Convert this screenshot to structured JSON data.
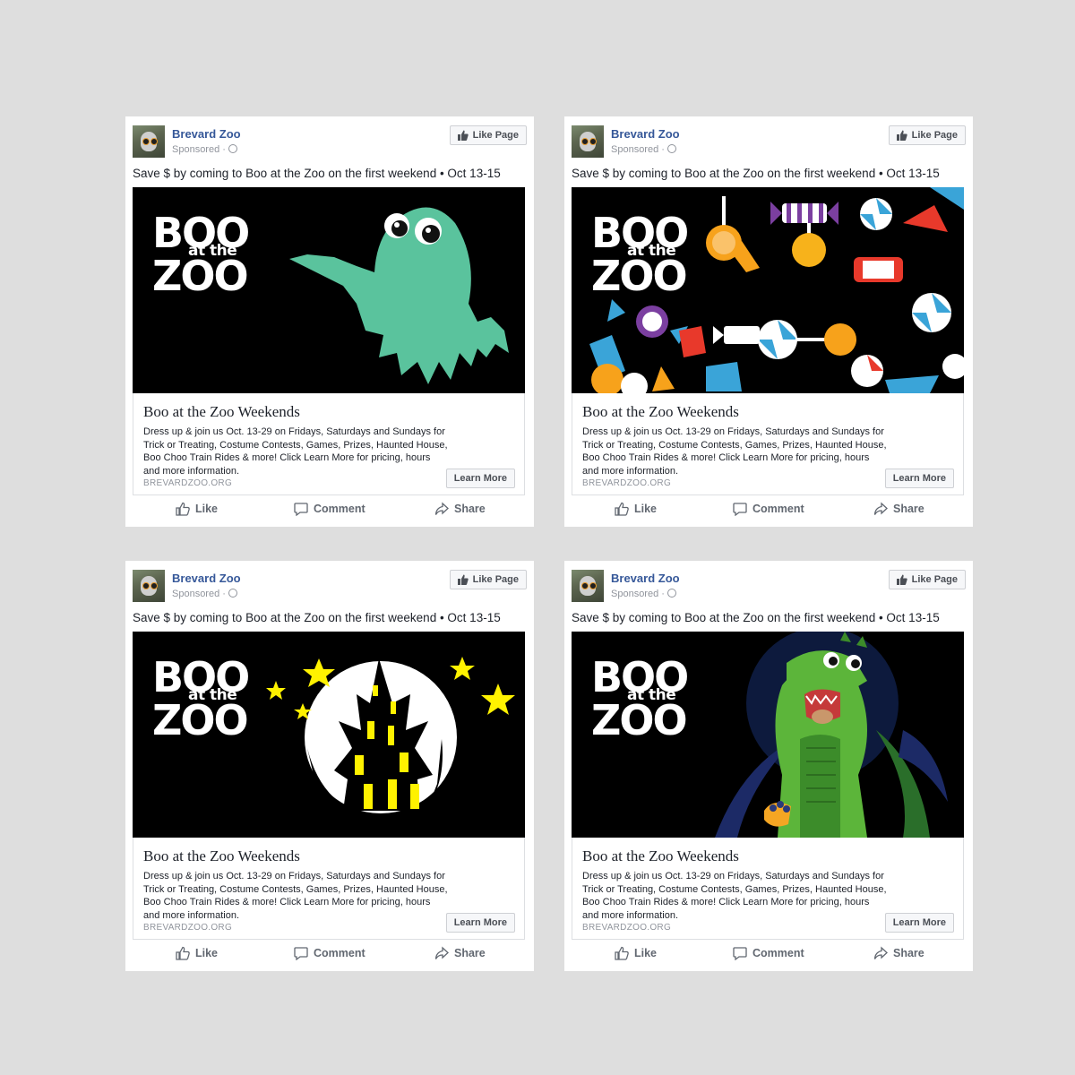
{
  "colors": {
    "background": "#dedede",
    "link_blue": "#365899",
    "ghost_green": "#5ac39d",
    "moon_white": "#ffffff",
    "window_yellow": "#fff200",
    "dino_green": "#5cb53a"
  },
  "posts": [
    {
      "page_name": "Brevard Zoo",
      "sponsored": "Sponsored ·",
      "like_page": "Like Page",
      "message": "Save $ by coming to Boo at the Zoo on the first weekend • Oct 13-15",
      "banner": {
        "logo_line1": "BOO",
        "logo_line2": "at the",
        "logo_line3": "ZOO",
        "art": "ghost"
      },
      "card_title": "Boo at the Zoo Weekends",
      "card_description": "Dress up & join us Oct. 13-29 on Fridays, Saturdays and Sundays for Trick or Treating, Costume Contests, Games, Prizes, Haunted House, Boo Choo Train Rides & more! Click Learn More for pricing, hours and more information.",
      "card_domain": "BREVARDZOO.ORG",
      "cta": "Learn More",
      "actions": {
        "like": "Like",
        "comment": "Comment",
        "share": "Share"
      }
    },
    {
      "page_name": "Brevard Zoo",
      "sponsored": "Sponsored ·",
      "like_page": "Like Page",
      "message": "Save $ by coming to Boo at the Zoo on the first weekend • Oct 13-15",
      "banner": {
        "logo_line1": "BOO",
        "logo_line2": "at the",
        "logo_line3": "ZOO",
        "art": "candy"
      },
      "card_title": "Boo at the Zoo Weekends",
      "card_description": "Dress up & join us Oct. 13-29 on Fridays, Saturdays and Sundays for Trick or Treating, Costume Contests, Games, Prizes, Haunted House, Boo Choo Train Rides & more! Click Learn More for pricing, hours and more information.",
      "card_domain": "BREVARDZOO.ORG",
      "cta": "Learn More",
      "actions": {
        "like": "Like",
        "comment": "Comment",
        "share": "Share"
      }
    },
    {
      "page_name": "Brevard Zoo",
      "sponsored": "Sponsored ·",
      "like_page": "Like Page",
      "message": "Save $ by coming to Boo at the Zoo on the first weekend • Oct 13-15",
      "banner": {
        "logo_line1": "BOO",
        "logo_line2": "at the",
        "logo_line3": "ZOO",
        "art": "haunted-house"
      },
      "card_title": "Boo at the Zoo Weekends",
      "card_description": "Dress up & join us Oct. 13-29 on Fridays, Saturdays and Sundays for Trick or Treating, Costume Contests, Games, Prizes, Haunted House, Boo Choo Train Rides & more! Click Learn More for pricing, hours and more information.",
      "card_domain": "BREVARDZOO.ORG",
      "cta": "Learn More",
      "actions": {
        "like": "Like",
        "comment": "Comment",
        "share": "Share"
      }
    },
    {
      "page_name": "Brevard Zoo",
      "sponsored": "Sponsored ·",
      "like_page": "Like Page",
      "message": "Save $ by coming to Boo at the Zoo on the first weekend • Oct 13-15",
      "banner": {
        "logo_line1": "BOO",
        "logo_line2": "at the",
        "logo_line3": "ZOO",
        "art": "dinosaur-costume"
      },
      "card_title": "Boo at the Zoo Weekends",
      "card_description": "Dress up & join us Oct. 13-29 on Fridays, Saturdays and Sundays for Trick or Treating, Costume Contests, Games, Prizes, Haunted House, Boo Choo Train Rides & more! Click Learn More for pricing, hours and more information.",
      "card_domain": "BREVARDZOO.ORG",
      "cta": "Learn More",
      "actions": {
        "like": "Like",
        "comment": "Comment",
        "share": "Share"
      }
    }
  ]
}
